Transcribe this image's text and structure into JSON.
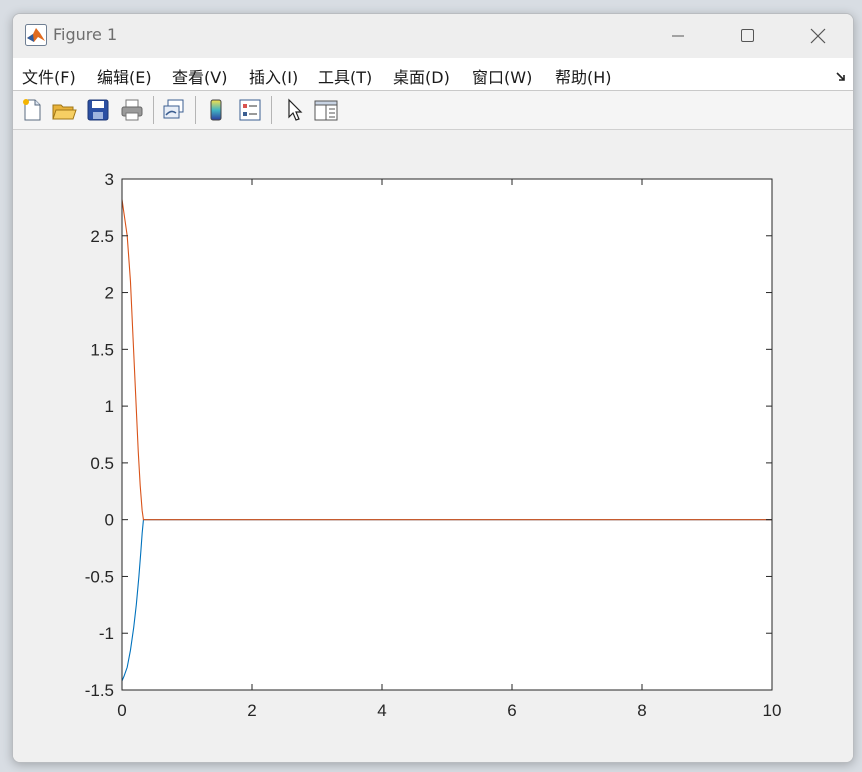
{
  "window": {
    "title": "Figure 1"
  },
  "menu": {
    "items": [
      "文件(F)",
      "编辑(E)",
      "查看(V)",
      "插入(I)",
      "工具(T)",
      "桌面(D)",
      "窗口(W)",
      "帮助(H)"
    ]
  },
  "toolbar": {
    "buttons": [
      "new-figure-icon",
      "open-file-icon",
      "save-icon",
      "print-icon",
      "link-plot-icon",
      "insert-colorbar-icon",
      "insert-legend-icon",
      "edit-plot-arrow-icon",
      "property-inspector-icon"
    ]
  },
  "colors": {
    "series1": "#0072BD",
    "series2": "#D95319"
  },
  "chart_data": {
    "type": "line",
    "title": "",
    "xlabel": "",
    "ylabel": "",
    "xlim": [
      0,
      10
    ],
    "ylim": [
      -1.5,
      3
    ],
    "xticks": [
      0,
      2,
      4,
      6,
      8,
      10
    ],
    "yticks": [
      3,
      2.5,
      2,
      1.5,
      1,
      0.5,
      0,
      -0.5,
      -1,
      -1.5
    ],
    "xtick_labels": [
      "0",
      "2",
      "4",
      "6",
      "8",
      "10"
    ],
    "ytick_labels": [
      "3",
      "2.5",
      "2",
      "1.5",
      "1",
      "0.5",
      "0",
      "-0.5",
      "-1",
      "-1.5"
    ],
    "grid": false,
    "series": [
      {
        "color": "#0072BD",
        "x": [
          0,
          0.03,
          0.08,
          0.13,
          0.18,
          0.22,
          0.26,
          0.29,
          0.31,
          0.33,
          10
        ],
        "y": [
          -1.42,
          -1.38,
          -1.3,
          -1.15,
          -0.95,
          -0.75,
          -0.5,
          -0.28,
          -0.12,
          0,
          0
        ]
      },
      {
        "color": "#D95319",
        "x": [
          0,
          0.03,
          0.08,
          0.13,
          0.17,
          0.21,
          0.25,
          0.28,
          0.31,
          0.33,
          10
        ],
        "y": [
          2.82,
          2.7,
          2.5,
          2.1,
          1.6,
          1.1,
          0.6,
          0.3,
          0.08,
          0,
          0
        ]
      }
    ]
  }
}
